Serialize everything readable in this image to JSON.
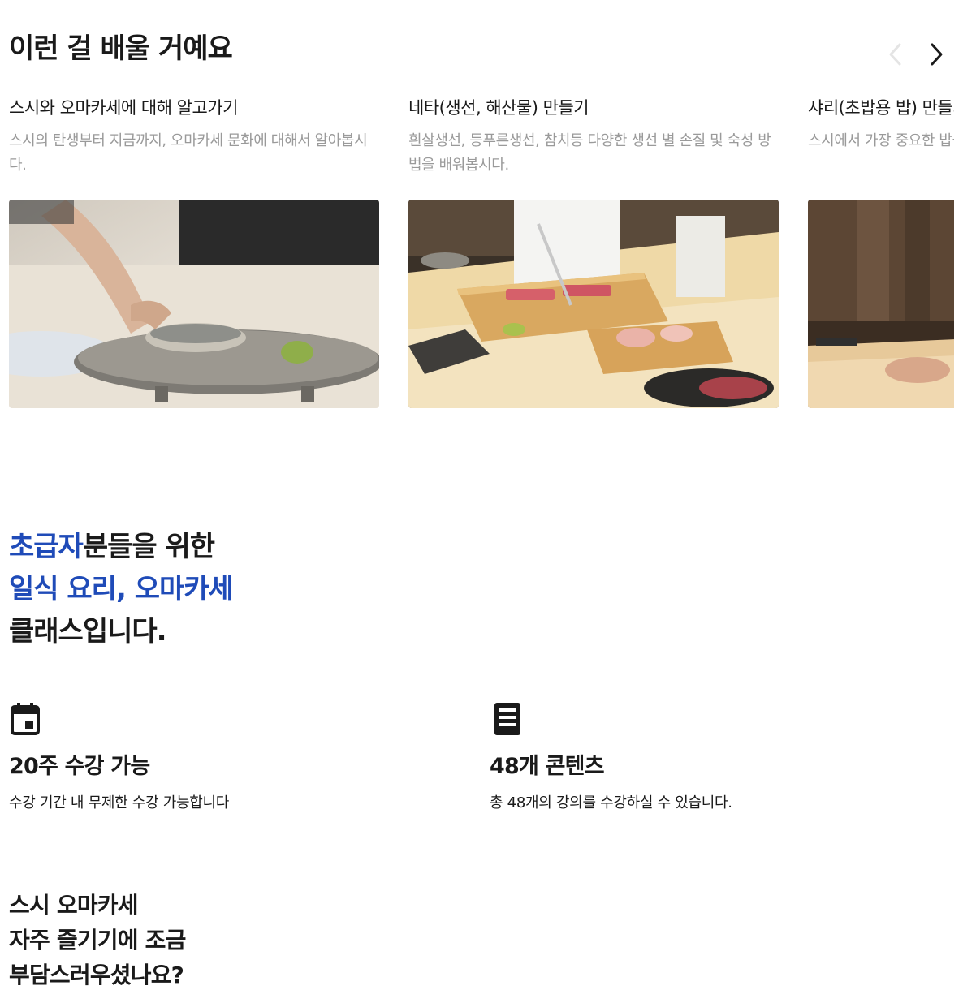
{
  "section": {
    "title": "이런 걸 배울 거예요"
  },
  "carousel": {
    "prev_icon": "chevron-left-icon",
    "next_icon": "chevron-right-icon",
    "cards": [
      {
        "title": "스시와 오마카세에 대해 알고가기",
        "description": "스시의 탄생부터 지금까지, 오마카세 문화에 대해서 알아봅시다."
      },
      {
        "title": "네타(생선, 해산물) 만들기",
        "description": "흰살생선, 등푸른생선, 참치등 다양한 생선 별 손질 및 숙성 방법을 배워봅시다."
      },
      {
        "title": "샤리(초밥용 밥) 만들기",
        "description": "스시에서 가장 중요한 밥을 만드는 방법을 배워봅시다."
      }
    ]
  },
  "intro": {
    "line1_highlight": "초급자",
    "line1_rest": "분들을 위한",
    "line2": "일식 요리, 오마카세",
    "line3": "클래스입니다.",
    "accent_color": "#1f4bb8"
  },
  "features": [
    {
      "icon": "calendar-icon",
      "title": "20주 수강 가능",
      "description": "수강 기간 내 무제한 수강 가능합니다"
    },
    {
      "icon": "document-icon",
      "title": "48개 콘텐츠",
      "description": "총 48개의 강의를 수강하실 수 있습니다."
    }
  ],
  "bottom": {
    "line1": "스시 오마카세",
    "line2": "자주 즐기기에 조금",
    "line3": "부담스러우셨나요?"
  }
}
